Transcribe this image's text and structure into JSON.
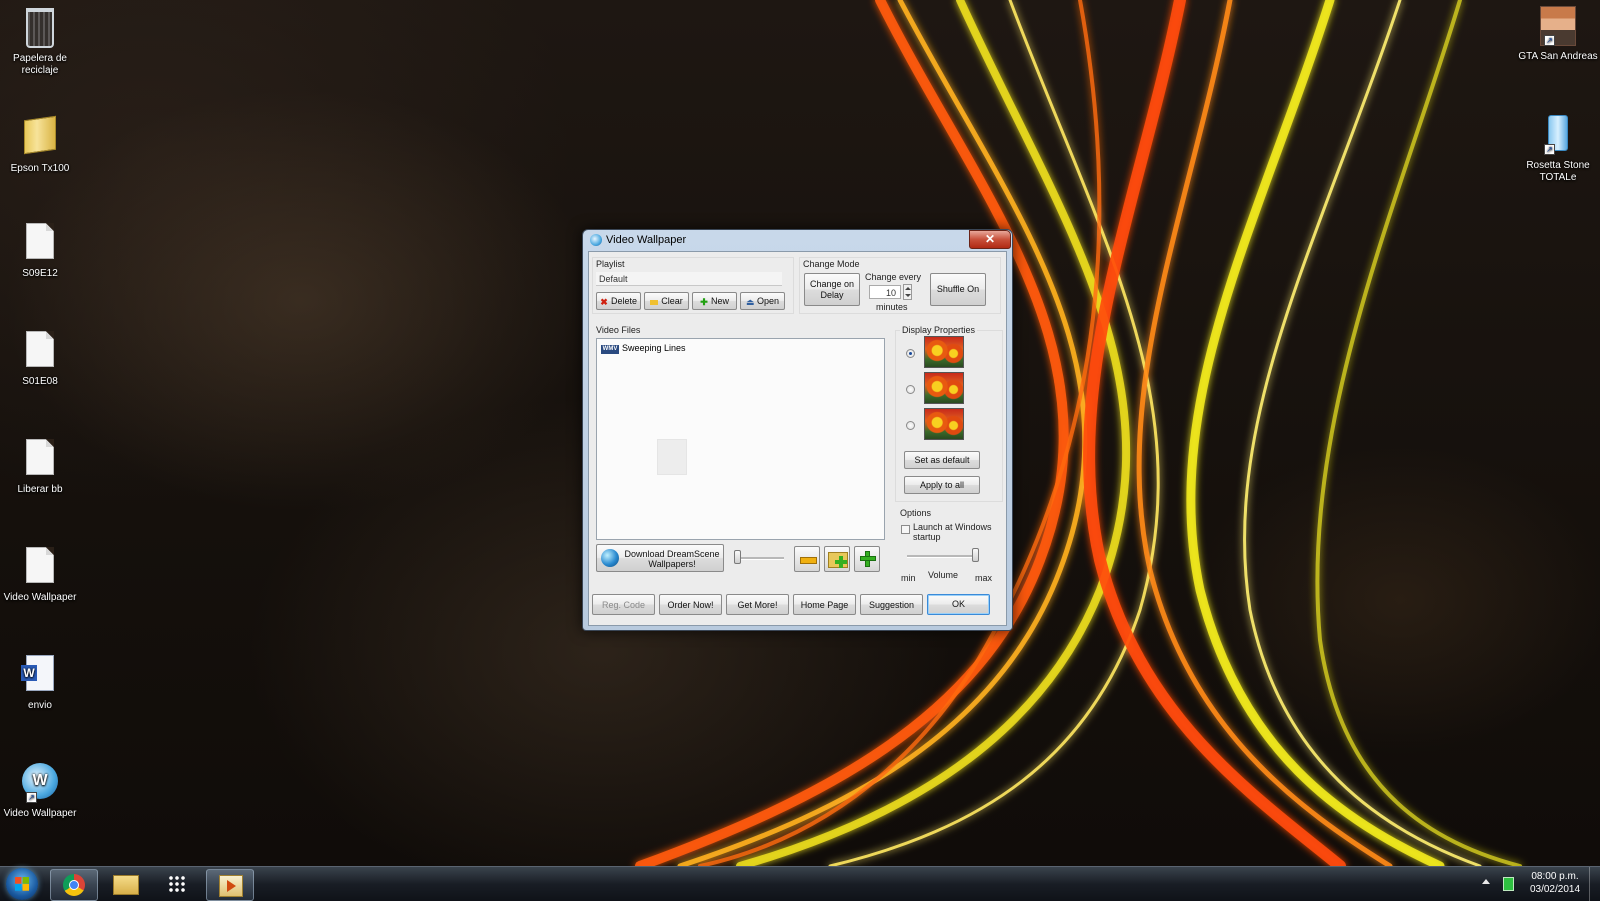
{
  "desktop": {
    "icons_left": [
      {
        "label": "Papelera de reciclaje",
        "icon": "recycle-bin-icon"
      },
      {
        "label": "Epson Tx100",
        "icon": "folder-icon"
      },
      {
        "label": "S09E12",
        "icon": "document-icon"
      },
      {
        "label": "S01E08",
        "icon": "document-icon"
      },
      {
        "label": "Liberar bb",
        "icon": "document-icon"
      },
      {
        "label": "Video Wallpaper",
        "icon": "document-icon"
      },
      {
        "label": "envio",
        "icon": "word-document-icon"
      },
      {
        "label": "Video Wallpaper",
        "icon": "video-wallpaper-shortcut-icon"
      }
    ],
    "icons_right": [
      {
        "label": "GTA San Andreas",
        "icon": "gta-shortcut-icon"
      },
      {
        "label": "Rosetta Stone TOTALe",
        "icon": "rosetta-stone-shortcut-icon"
      }
    ]
  },
  "dialog": {
    "title": "Video Wallpaper",
    "close_label": "✕",
    "playlist": {
      "label": "Playlist",
      "current": "Default",
      "buttons": {
        "delete": "Delete",
        "clear": "Clear",
        "new": "New",
        "open": "Open"
      }
    },
    "change_mode": {
      "label": "Change Mode",
      "change_on_delay": "Change on Delay",
      "change_every_label": "Change every",
      "interval_value": "10",
      "interval_unit": "minutes",
      "shuffle": "Shuffle On"
    },
    "video_files": {
      "label": "Video Files",
      "items": [
        {
          "format": "WMV",
          "name": "Sweeping Lines"
        }
      ]
    },
    "display_properties": {
      "label": "Display Properties",
      "selected_index": 0,
      "set_default": "Set as default",
      "apply_all": "Apply to all"
    },
    "options": {
      "label": "Options",
      "launch_startup": "Launch at Windows startup",
      "launch_startup_checked": false,
      "volume_label": "Volume",
      "volume_min": "min",
      "volume_max": "max",
      "volume_level": 1.0
    },
    "download_button": "Download DreamScene Wallpapers!",
    "speed_level": 0.0,
    "footer": {
      "reg_code": "Reg. Code",
      "order_now": "Order Now!",
      "get_more": "Get More!",
      "home_page": "Home Page",
      "suggestion": "Suggestion",
      "ok": "OK"
    }
  },
  "taskbar": {
    "time": "08:00 p.m.",
    "date": "03/02/2014",
    "pinned": [
      {
        "name": "chrome",
        "icon": "chrome-icon"
      },
      {
        "name": "explorer",
        "icon": "folder-icon"
      },
      {
        "name": "apps",
        "icon": "apps-grid-icon"
      },
      {
        "name": "video-wallpaper",
        "icon": "video-wallpaper-icon",
        "active": true
      }
    ]
  }
}
